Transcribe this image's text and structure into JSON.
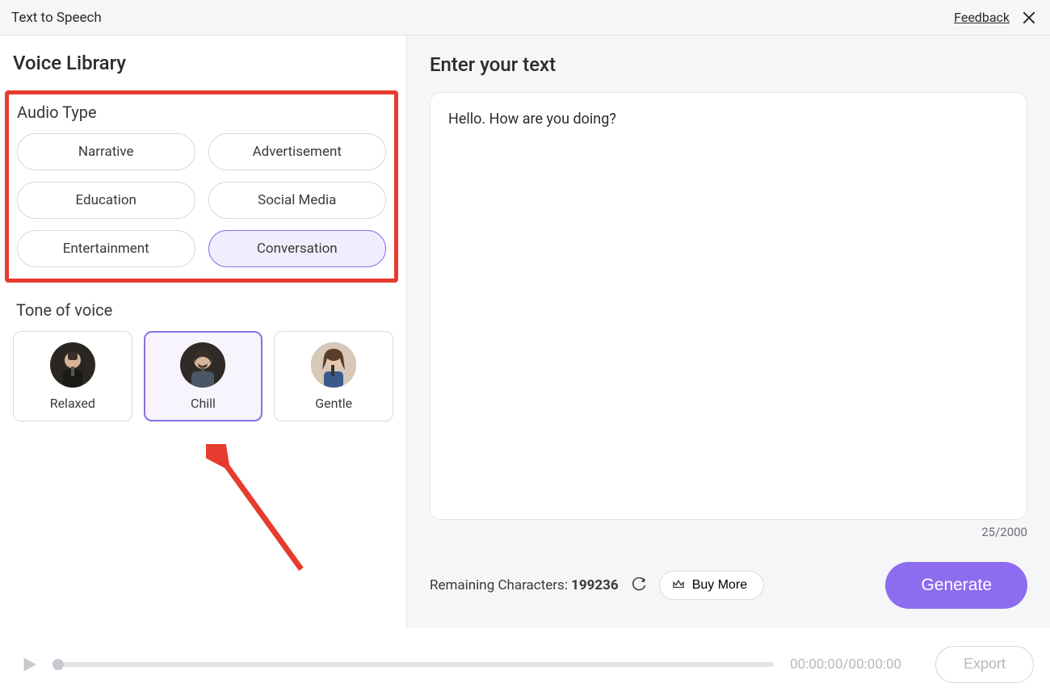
{
  "topbar": {
    "title": "Text to Speech",
    "feedback": "Feedback"
  },
  "sidebar": {
    "title": "Voice Library",
    "audio_type_label": "Audio Type",
    "audio_types": [
      "Narrative",
      "Advertisement",
      "Education",
      "Social Media",
      "Entertainment",
      "Conversation"
    ],
    "audio_type_selected": 5,
    "tone_label": "Tone of voice",
    "tones": [
      "Relaxed",
      "Chill",
      "Gentle"
    ],
    "tone_selected": 1
  },
  "content": {
    "heading": "Enter your text",
    "text_value": "Hello. How are you doing?",
    "char_count": "25/2000",
    "remaining_label": "Remaining Characters: ",
    "remaining_value": "199236",
    "buy_more": "Buy More",
    "generate": "Generate"
  },
  "player": {
    "time": "00:00:00/00:00:00",
    "export": "Export"
  }
}
